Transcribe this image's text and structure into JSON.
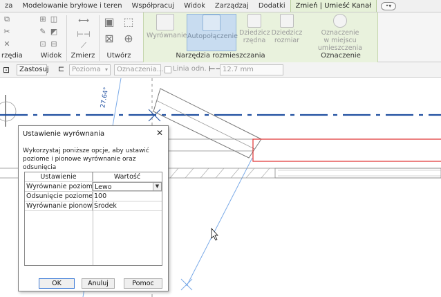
{
  "tabs": [
    {
      "label": "za",
      "active": false
    },
    {
      "label": "Modelowanie bryłowe i teren",
      "active": false
    },
    {
      "label": "Współpracuj",
      "active": false
    },
    {
      "label": "Widok",
      "active": false
    },
    {
      "label": "Zarządzaj",
      "active": false
    },
    {
      "label": "Dodatki",
      "active": false
    },
    {
      "label": "Zmień | Umieść Kanał",
      "active": true
    }
  ],
  "ribbon": {
    "panels": {
      "widok": "Widok",
      "zmierz": "Zmierz",
      "utworz": "Utwórz",
      "narzedzia": "Narzędzia rozmieszczania",
      "oznaczenie": "Oznaczenie"
    },
    "left_label": "rzędia",
    "buttons": {
      "wyrownanie": "Wyrównanie",
      "autopolaczenie": "Autopołączenie",
      "dziedzicz_rzedna_1": "Dziedzicz",
      "dziedzicz_rzedna_2": "rzędna",
      "dziedzicz_rozmiar_1": "Dziedzicz",
      "dziedzicz_rozmiar_2": "rozmiar",
      "oznaczenie_1": "Oznaczenie",
      "oznaczenie_2": "w miejscu umieszczenia"
    }
  },
  "optionsbar": {
    "apply": "Zastosuj",
    "orientation": "Pozioma",
    "tag_placeholder": "Oznaczenia...",
    "leader_label": "Linia odn.",
    "length": "12.7 mm"
  },
  "canvas": {
    "angle_label": "27.64°"
  },
  "dialog": {
    "title": "Ustawienie wyrównania",
    "description": "Wykorzystaj poniższe opcje, aby ustawić poziome i pionowe wyrównanie oraz odsunięcia",
    "headers": [
      "Ustawienie",
      "Wartość"
    ],
    "rows": [
      {
        "setting": "Wyrównanie poziome",
        "value": "Lewo"
      },
      {
        "setting": "Odsunięcie poziome",
        "value": "100"
      },
      {
        "setting": "Wyrównanie pionowe",
        "value": "Środek"
      }
    ],
    "buttons": {
      "ok": "OK",
      "cancel": "Anuluj",
      "help": "Pomoc"
    }
  },
  "colors": {
    "context_tab": "#e6f1d8",
    "active_button": "#c8dcf0",
    "dash_line": "#1f4fa0",
    "guide_line": "#7aaae8",
    "red_outline": "#e03030"
  }
}
